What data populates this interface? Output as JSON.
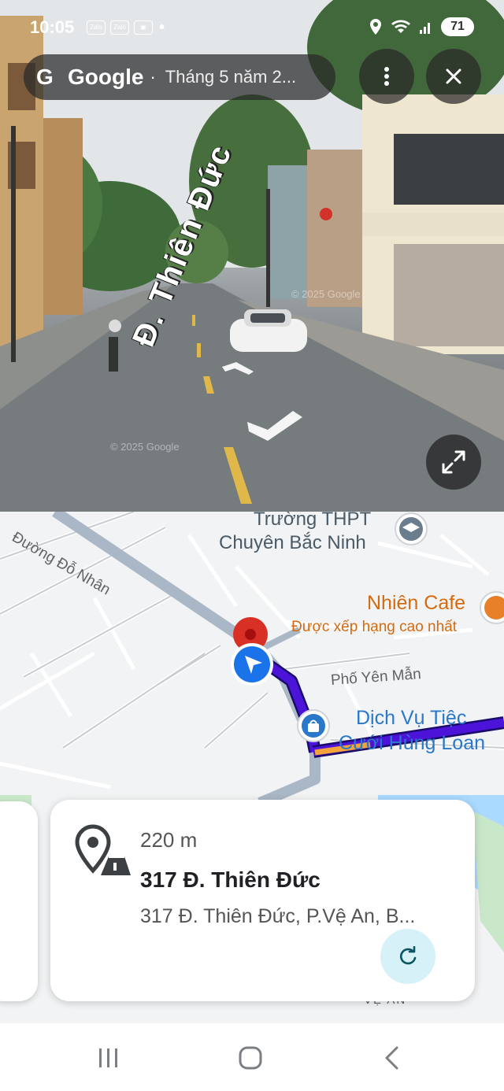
{
  "status": {
    "time": "10:05",
    "apps": [
      "Zalo",
      "Zalo"
    ],
    "battery": "71"
  },
  "streetview": {
    "brand": "Google",
    "date": "Tháng 5 năm 2...",
    "road_label": "Đ. Thiên Đức",
    "watermark": "© 2025 Google",
    "icons": [
      "more-vert-icon",
      "close-icon",
      "expand-icon",
      "nav-arrow-icon"
    ]
  },
  "map": {
    "poi_school_line1": "Trường THPT",
    "poi_school_line2": "Chuyên Bắc Ninh",
    "poi_cafe": "Nhiên Cafe",
    "poi_cafe_sub": "Được xếp hạng cao nhất",
    "street_yen_man": "Phố Yên Mẫn",
    "poi_wedding_line1": "Dịch Vụ Tiệc",
    "poi_wedding_line2": "Cưới Hùng Loan",
    "street_do_nhan": "Đường Đỗ Nhân",
    "area_ve_an": "VỆ AN",
    "colors": {
      "route": "#4b14d8",
      "route_alt": "#f3a33a",
      "water": "#aadaff",
      "park": "#c9e7c9"
    }
  },
  "card": {
    "distance": "220 m",
    "title": "317 Đ. Thiên Đức",
    "address": "317 Đ. Thiên Đức, P.Vệ An, B..."
  }
}
